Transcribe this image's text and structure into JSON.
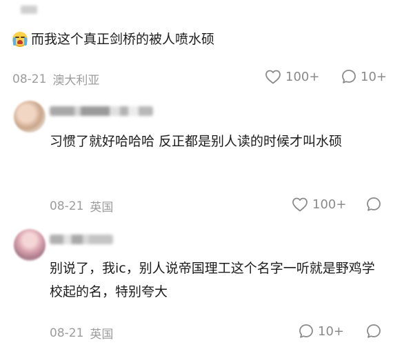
{
  "comment_main": {
    "text": "而我这个真正剑桥的被人喷水硕",
    "date": "08-21",
    "location": "澳大利亚",
    "likes": "100+",
    "replies": "10+",
    "emoji_icon": "crying-laughing-emoji"
  },
  "replies": [
    {
      "text": "习惯了就好哈哈哈 反正都是别人读的时候才叫水硕",
      "date": "08-21",
      "location": "英国",
      "likes": "100+"
    },
    {
      "text": "别说了，我ic，别人说帝国理工这个名字一听就是野鸡学校起的名，特别夸大",
      "date": "08-21",
      "location": "英国",
      "replies": "10+"
    }
  ],
  "icons": {
    "like": "heart-outline-icon",
    "comment": "speech-bubble-icon"
  },
  "colors": {
    "text": "#1c1c1c",
    "meta": "#9c9c9c",
    "icon": "#8a8a8a",
    "background": "#ffffff"
  }
}
